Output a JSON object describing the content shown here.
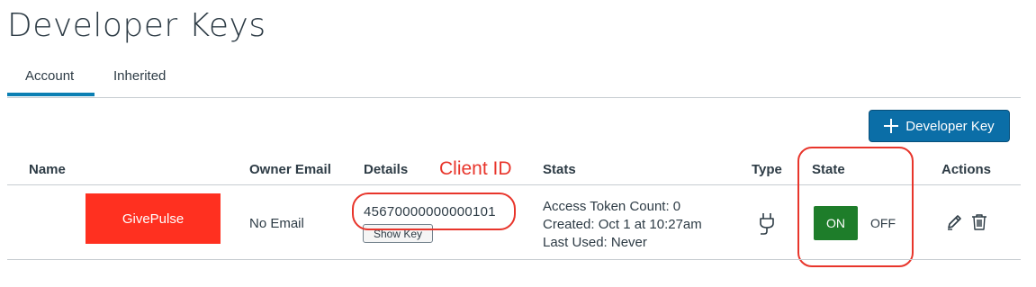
{
  "page": {
    "title": "Developer Keys"
  },
  "tabs": [
    {
      "label": "Account",
      "active": true
    },
    {
      "label": "Inherited",
      "active": false
    }
  ],
  "toolbar": {
    "add_button_label": "Developer Key",
    "add_icon": "plus-icon"
  },
  "table": {
    "columns": [
      "Name",
      "Owner Email",
      "Details",
      "Stats",
      "Type",
      "State",
      "Actions"
    ],
    "rows": [
      {
        "name_logo_text": "GivePulse",
        "owner_email": "No Email",
        "client_id": "45670000000000101",
        "show_key_label": "Show Key",
        "stats": {
          "access_token_count": "Access Token Count: 0",
          "created": "Created: Oct 1 at 10:27am",
          "last_used": "Last Used: Never"
        },
        "type_icon": "plug-icon",
        "state": {
          "on_label": "ON",
          "off_label": "OFF",
          "selected": "ON"
        },
        "actions": [
          "edit-icon",
          "trash-icon"
        ]
      }
    ]
  },
  "annotations": {
    "client_id_label": "Client ID"
  },
  "colors": {
    "accent": "#0b6ea7",
    "tab_active": "#0b7fb3",
    "state_on": "#1e7d2a",
    "annotation": "#e8352b",
    "logo_bg": "#ff3020"
  }
}
